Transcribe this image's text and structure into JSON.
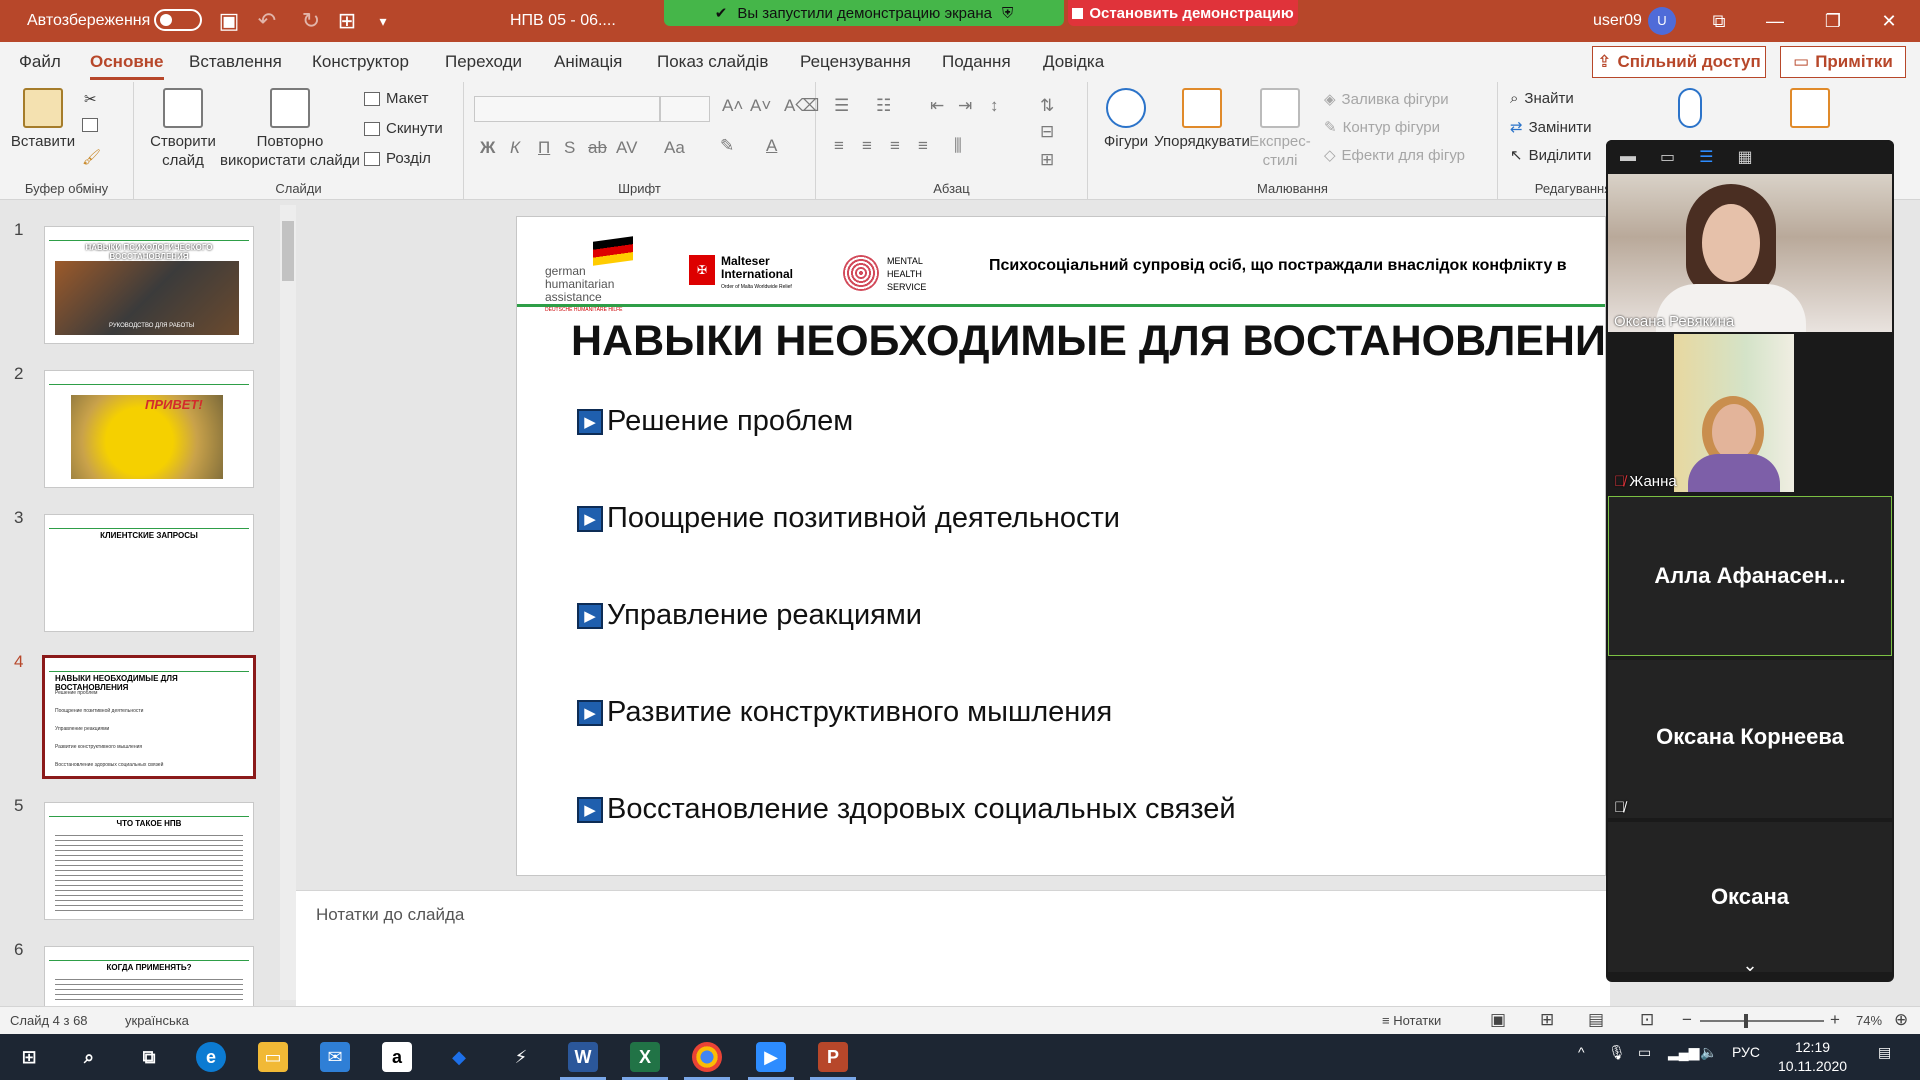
{
  "titlebar": {
    "autosave_label": "Автозбереження",
    "document_title": "НПВ 05 - 06....",
    "share_banner": "Вы запустили демонстрацию экрана",
    "stop_share": "Остановить демонстрацию",
    "user": "user09",
    "avatar_initial": "U"
  },
  "menu": {
    "tabs": [
      "Файл",
      "Основне",
      "Вставлення",
      "Конструктор",
      "Переходи",
      "Анімація",
      "Показ слайдів",
      "Рецензування",
      "Подання",
      "Довідка"
    ],
    "share_button": "Спільний доступ",
    "notes_button": "Примітки"
  },
  "ribbon": {
    "clipboard": {
      "paste": "Вставити",
      "label": "Буфер обміну"
    },
    "slides": {
      "new_slide": "Створити слайд",
      "reuse": "Повторно використати слайди",
      "layout": "Макет",
      "reset": "Скинути",
      "section": "Розділ",
      "label": "Слайди"
    },
    "font": {
      "label": "Шрифт",
      "bold": "Ж",
      "italic": "К",
      "underline": "П",
      "shadow": "S",
      "strike": "ab",
      "spacing": "AV",
      "case": "Aa"
    },
    "paragraph": {
      "label": "Абзац"
    },
    "drawing": {
      "shapes": "Фігури",
      "arrange": "Упорядкувати",
      "quick_styles": "Експрес-стилі",
      "fill": "Заливка фігури",
      "outline": "Контур фігури",
      "effects": "Ефекти для фігур",
      "label": "Малювання"
    },
    "editing": {
      "find": "Знайти",
      "replace": "Замінити",
      "select": "Виділити",
      "label": "Редагування"
    }
  },
  "thumbnails": [
    {
      "num": "1",
      "title": "НАВЫКИ ПСИХОЛОГИЧЕСКОГО ВОССТАНОВЛЕНИЯ",
      "subtitle": "РУКОВОДСТВО ДЛЯ РАБОТЫ"
    },
    {
      "num": "2",
      "title": "ПРИВЕТ!"
    },
    {
      "num": "3",
      "title": "КЛИЕНТСКИЕ ЗАПРОСЫ"
    },
    {
      "num": "4",
      "title": "НАВЫКИ НЕОБХОДИМЫЕ ДЛЯ ВОСТАНОВЛЕНИЯ",
      "lines": [
        "Решение проблем",
        "Поощрение позитивной деятельности",
        "Управление реакциями",
        "Развитие конструктивного мышления",
        "Восстановление здоровых социальных связей"
      ]
    },
    {
      "num": "5",
      "title": "ЧТО ТАКОЕ НПВ"
    },
    {
      "num": "6",
      "title": "КОГДА ПРИМЕНЯТЬ?"
    }
  ],
  "slide": {
    "logo_german": [
      "german",
      "humanitarian",
      "assistance"
    ],
    "logo_german_sub": "DEUTSCHE HUMANITÄRE HILFE",
    "logo_malteser": [
      "Malteser",
      "International"
    ],
    "logo_malteser_sub": "Order of Malta Worldwide Relief",
    "logo_mhs": [
      "MENTAL",
      "HEALTH",
      "SERVICE"
    ],
    "tagline": "Психосоціальний супровід осіб, що постраждали внаслідок конфлікту в",
    "title": "НАВЫКИ НЕОБХОДИМЫЕ ДЛЯ ВОСТАНОВЛЕНИЯ",
    "bullets": [
      "Решение проблем",
      "Поощрение позитивной деятельности",
      "Управление реакциями",
      "Развитие конструктивного мышления",
      "Восстановление здоровых социальных связей"
    ]
  },
  "notes_placeholder": "Нотатки до слайда",
  "zoom": {
    "participants": [
      {
        "name": "Оксана Ревякина"
      },
      {
        "name": "Жанна"
      },
      {
        "name": "Алла  Афанасен..."
      },
      {
        "name": "Оксана Корнеева"
      },
      {
        "name": "Оксана"
      }
    ]
  },
  "status": {
    "slide_counter": "Слайд 4 з 68",
    "language": "українська",
    "notes": "Нотатки",
    "zoom_percent": "74%"
  },
  "taskbar": {
    "lang": "РУС",
    "time": "12:19",
    "date": "10.11.2020"
  },
  "colors": {
    "accent": "#b7472a",
    "green": "#2e9e47",
    "selected_border": "#8b1a1a"
  }
}
